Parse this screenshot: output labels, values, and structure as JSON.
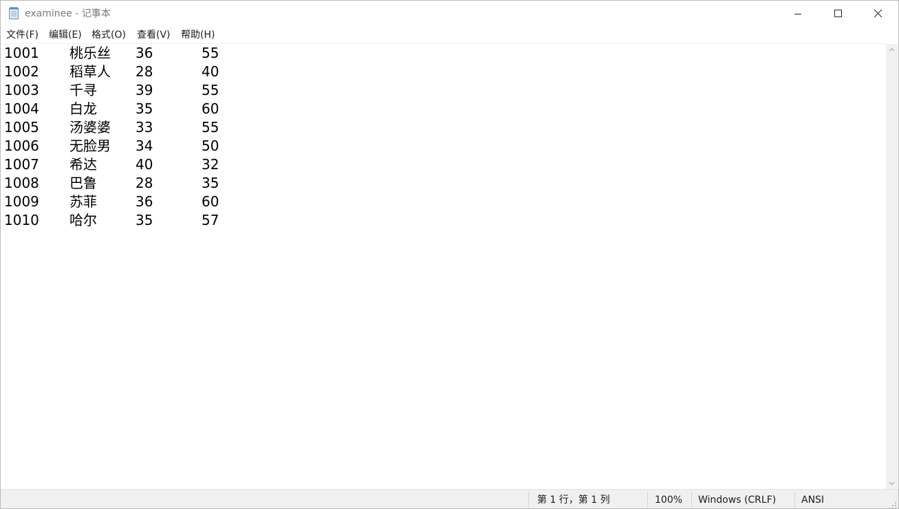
{
  "window": {
    "title": "examinee - 记事本"
  },
  "menu": [
    "文件(F)",
    "编辑(E)",
    "格式(O)",
    "查看(V)",
    "帮助(H)"
  ],
  "editor": {
    "rows": [
      {
        "id": "1001",
        "name": "桃乐丝",
        "a": "36",
        "b": "55"
      },
      {
        "id": "1002",
        "name": "稻草人",
        "a": "28",
        "b": "40"
      },
      {
        "id": "1003",
        "name": "千寻",
        "a": "39",
        "b": "55"
      },
      {
        "id": "1004",
        "name": "白龙",
        "a": "35",
        "b": "60"
      },
      {
        "id": "1005",
        "name": "汤婆婆",
        "a": "33",
        "b": "55"
      },
      {
        "id": "1006",
        "name": "无脸男",
        "a": "34",
        "b": "50"
      },
      {
        "id": "1007",
        "name": "希达",
        "a": "40",
        "b": "32"
      },
      {
        "id": "1008",
        "name": "巴鲁",
        "a": "28",
        "b": "35"
      },
      {
        "id": "1009",
        "name": "苏菲",
        "a": "36",
        "b": "60"
      },
      {
        "id": "1010",
        "name": "哈尔",
        "a": "35",
        "b": "57"
      }
    ]
  },
  "status": {
    "position": "第 1 行，第 1 列",
    "zoom": "100%",
    "line_ending": "Windows (CRLF)",
    "encoding": "ANSI"
  },
  "icons": {
    "app": "notepad-icon",
    "minimize": "minimize-icon",
    "maximize": "maximize-icon",
    "close": "close-icon",
    "scroll_up": "scroll-up-arrow-icon",
    "scroll_down": "scroll-down-arrow-icon",
    "grip": "resize-grip-icon"
  }
}
